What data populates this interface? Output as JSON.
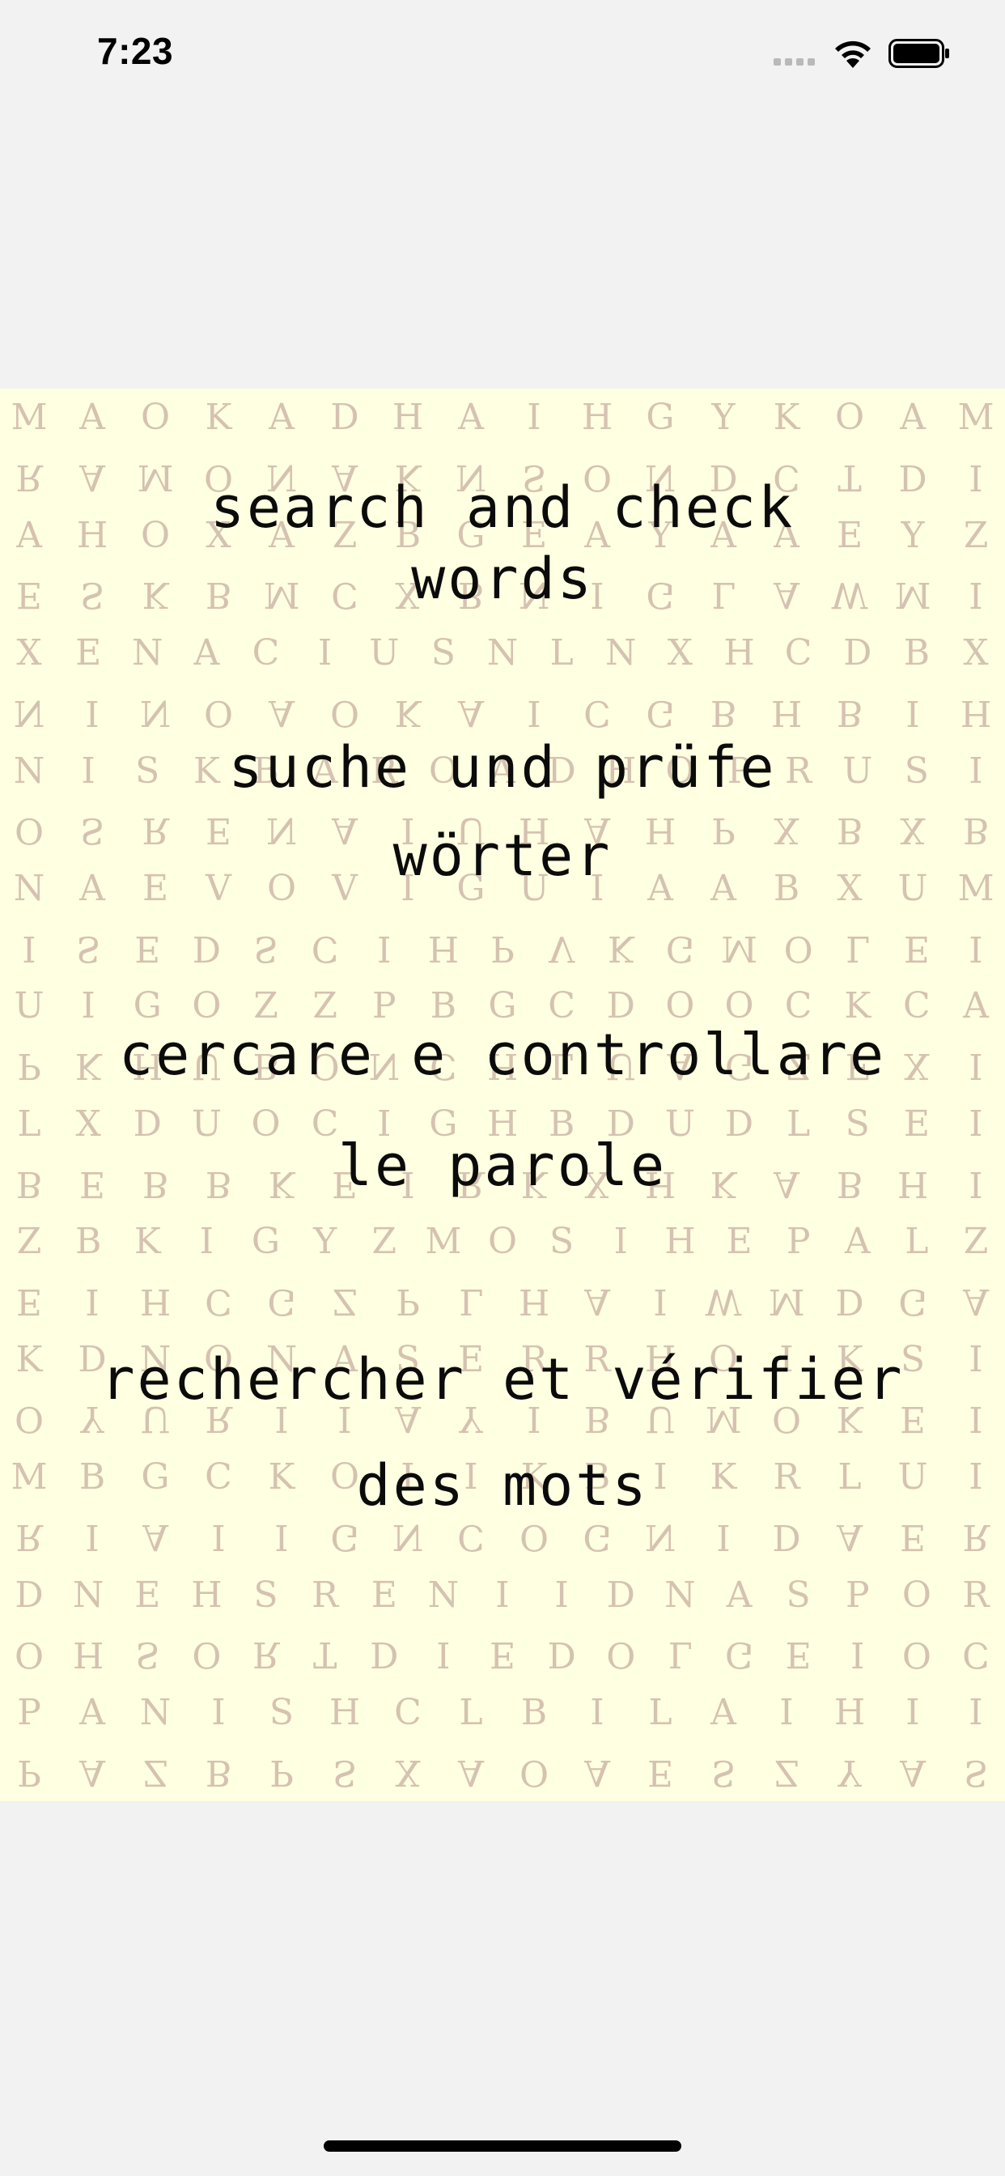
{
  "status_bar": {
    "time": "7:23",
    "icons": [
      "cellular-signal-icon",
      "wifi-icon",
      "battery-icon"
    ]
  },
  "phrases": [
    {
      "line1": "search and check",
      "line2": "words"
    },
    {
      "line1": "suche und prüfe",
      "line2": "wörter"
    },
    {
      "line1": "cercare e controllare",
      "line2": "le parole"
    },
    {
      "line1": "rechercher et vérifier",
      "line2": "des mots"
    }
  ],
  "letter_grid": [
    "MAOKADHAIHGYKOAM",
    "RAMONAKNSONDCTDI",
    "AHOXAZBGEAYAAEYZ",
    "ESKBMCXBNIGLAWMI",
    "XENACIUSNLNXHCDBX",
    "NINOAOKAICGBHBIH",
    "NISKBAROADHOPRUSI",
    "OSRENAIUHAHPXBXB",
    "NAEVOVIGUIAABXUM",
    "ISEDSCIHPVKGMOLEI",
    "UIGOZZPBGCDOOCKCA",
    "PKHUBONCHLUAGZFXI",
    "LXDUOCIGHBDUDLSEI",
    "BEBBKEIRKXHKABHI",
    "ZBKIGYZMOSIHEPALZ",
    "EIHCGZPLHAIWMDGA",
    "KDNONASERRHOIKSI",
    "OYURIIAYIBUMOKEI",
    "MBGCKOIIKBIKRLUI",
    "RIAIIGNCOGNIDAER",
    "DNEHSRENIIDNASPOR",
    "OHSORTDIEDOLGEIOC",
    "PANISHCLBILAIHII",
    "PAZBPSXAOAESZYAS"
  ]
}
